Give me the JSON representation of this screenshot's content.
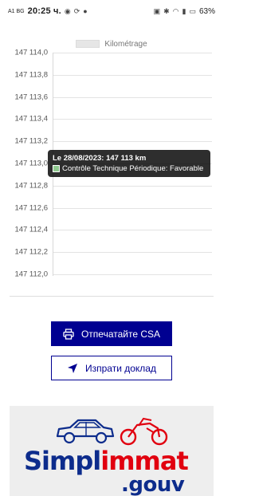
{
  "status_bar": {
    "carrier": "A1 BG",
    "time": "20:25 ч.",
    "battery": "63%"
  },
  "chart_data": {
    "type": "line",
    "legend": [
      "Kilométrage"
    ],
    "legend_position": "top",
    "series": [
      {
        "name": "Kilométrage",
        "x": [
          "28/08/2023"
        ],
        "values": [
          147113
        ]
      }
    ],
    "ylim": [
      147112.0,
      147114.0
    ],
    "y_ticks": [
      "147 114,0",
      "147 113,8",
      "147 113,6",
      "147 113,4",
      "147 113,2",
      "147 113,0",
      "147 112,8",
      "147 112,6",
      "147 112,4",
      "147 112,2",
      "147 112,0"
    ],
    "grid": true,
    "colors": {
      "series": "#e6e6e6",
      "tooltip_swatch": "#8fc98f"
    },
    "tooltip": {
      "title": "Le 28/08/2023: 147 113 km",
      "line": "Contrôle Technique Périodique: Favorable"
    }
  },
  "actions": {
    "print_label": "Отпечатайте CSA",
    "send_label": "Изпрати доклад",
    "accent_color": "#000091"
  },
  "logo": {
    "part1": "Simpl",
    "part2": "immat",
    "suffix": ".gouv"
  }
}
